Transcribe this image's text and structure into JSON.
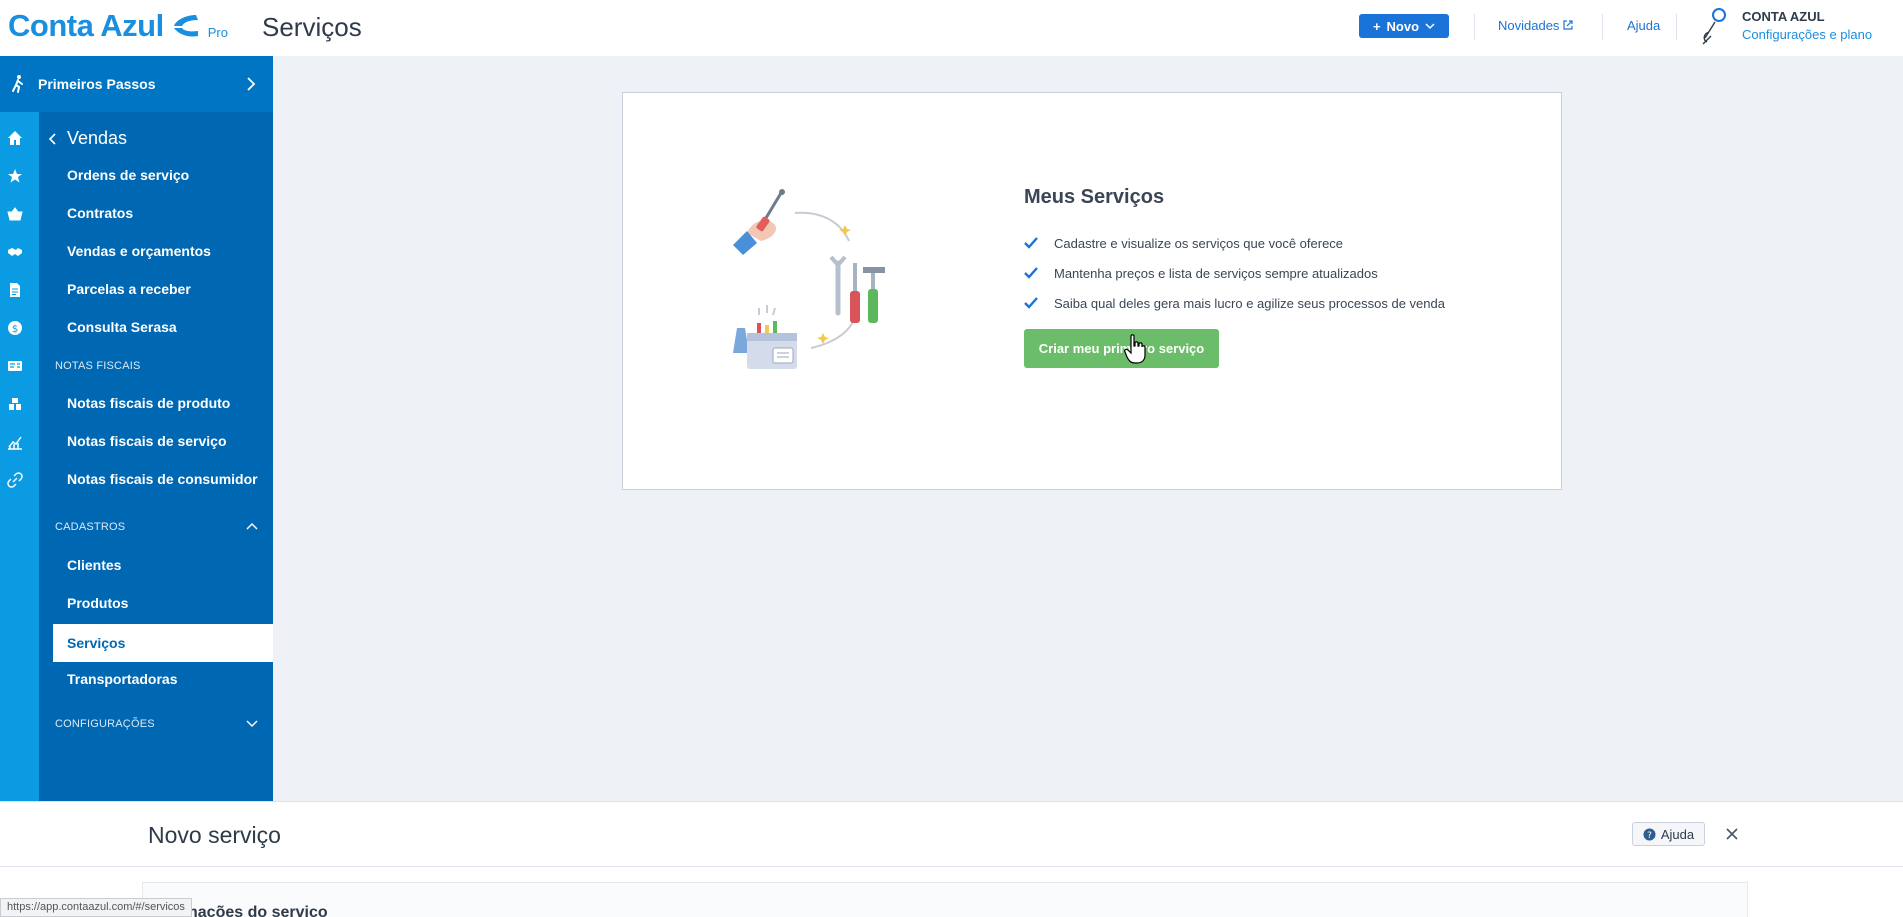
{
  "header": {
    "logo_text": "Conta Azul",
    "logo_badge": "Pro",
    "page_title": "Serviços",
    "new_button": "Novo",
    "news_link": "Novidades",
    "help_link": "Ajuda",
    "account_name": "CONTA AZUL",
    "account_plan": "Configurações e plano"
  },
  "sidebar": {
    "first_steps": "Primeiros Passos",
    "back_label": "Vendas",
    "sales_items": [
      "Ordens de serviço",
      "Contratos",
      "Vendas e orçamentos",
      "Parcelas a receber",
      "Consulta Serasa"
    ],
    "section_invoices": "NOTAS FISCAIS",
    "invoice_items": [
      "Notas fiscais de produto",
      "Notas fiscais de serviço",
      "Notas fiscais de consumidor"
    ],
    "section_registers": "CADASTROS",
    "register_items": [
      "Clientes",
      "Produtos",
      "Serviços",
      "Transportadoras"
    ],
    "section_settings": "CONFIGURAÇÕES"
  },
  "main": {
    "title": "Meus Serviços",
    "bullets": [
      "Cadastre e visualize os serviços que você oferece",
      "Mantenha preços e lista de serviços sempre atualizados",
      "Saiba qual deles gera mais lucro e agilize seus processos de venda"
    ],
    "cta": "Criar meu primeiro serviço"
  },
  "panel": {
    "title": "Novo serviço",
    "help": "Ajuda",
    "section_title": "Informações do serviço"
  },
  "status_bar": {
    "url": "https://app.contaazul.com/#/servicos"
  },
  "colors": {
    "brand_blue": "#1a8fe0",
    "nav_dark": "#0068b3",
    "nav_rail": "#0a9be3",
    "cta_green": "#6cbd6a"
  }
}
